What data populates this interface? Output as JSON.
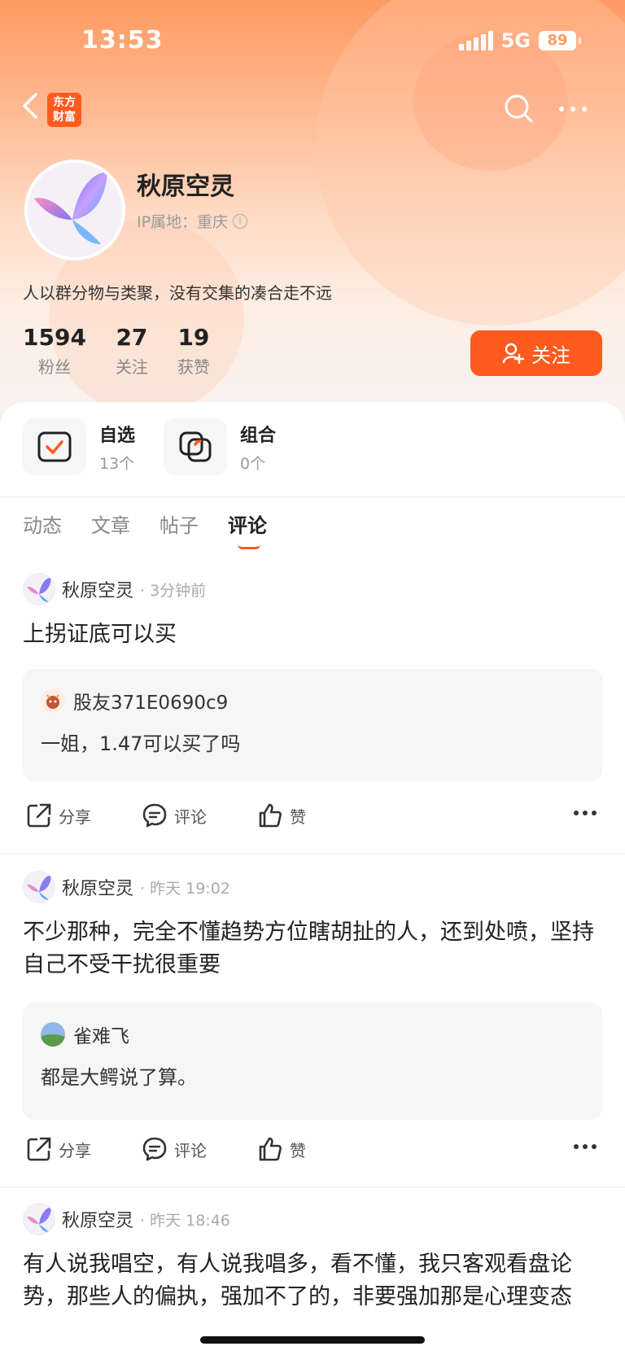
{
  "status_bar": {
    "time": "13:53",
    "network": "5G",
    "battery": "89"
  },
  "nav": {
    "logo_line1": "东方",
    "logo_line2": "财富"
  },
  "profile": {
    "name": "秋原空灵",
    "ip_label": "IP属地：重庆",
    "bio": "人以群分物与类聚，没有交集的凑合走不远",
    "stats": [
      {
        "value": "1594",
        "label": "粉丝"
      },
      {
        "value": "27",
        "label": "关注"
      },
      {
        "value": "19",
        "label": "获赞"
      }
    ],
    "follow_label": "关注"
  },
  "shortcuts": [
    {
      "title": "自选",
      "count": "13个"
    },
    {
      "title": "组合",
      "count": "0个"
    }
  ],
  "tabs": [
    "动态",
    "文章",
    "帖子",
    "评论"
  ],
  "active_tab": "评论",
  "posts": [
    {
      "author": "秋原空灵",
      "time": "· 3分钟前",
      "text": "上拐证底可以买",
      "quote_author": "股友371E0690c9",
      "quote_text": "一姐，1.47可以买了吗"
    },
    {
      "author": "秋原空灵",
      "time": "· 昨天 19:02",
      "text": "不少那种，完全不懂趋势方位瞎胡扯的人，还到处喷，坚持自己不受干扰很重要",
      "quote_author": "雀难飞",
      "quote_text": "都是大鳄说了算。"
    },
    {
      "author": "秋原空灵",
      "time": "· 昨天 18:46",
      "text": "有人说我唱空，有人说我唱多，看不懂，我只客观看盘论势，那些人的偏执，强加不了的，非要强加那是心理变态"
    }
  ],
  "actions": {
    "share": "分享",
    "comment": "评论",
    "like": "赞"
  },
  "colors": {
    "accent": "#ff5a1f",
    "header_gradient_top": "#ff9a62"
  }
}
